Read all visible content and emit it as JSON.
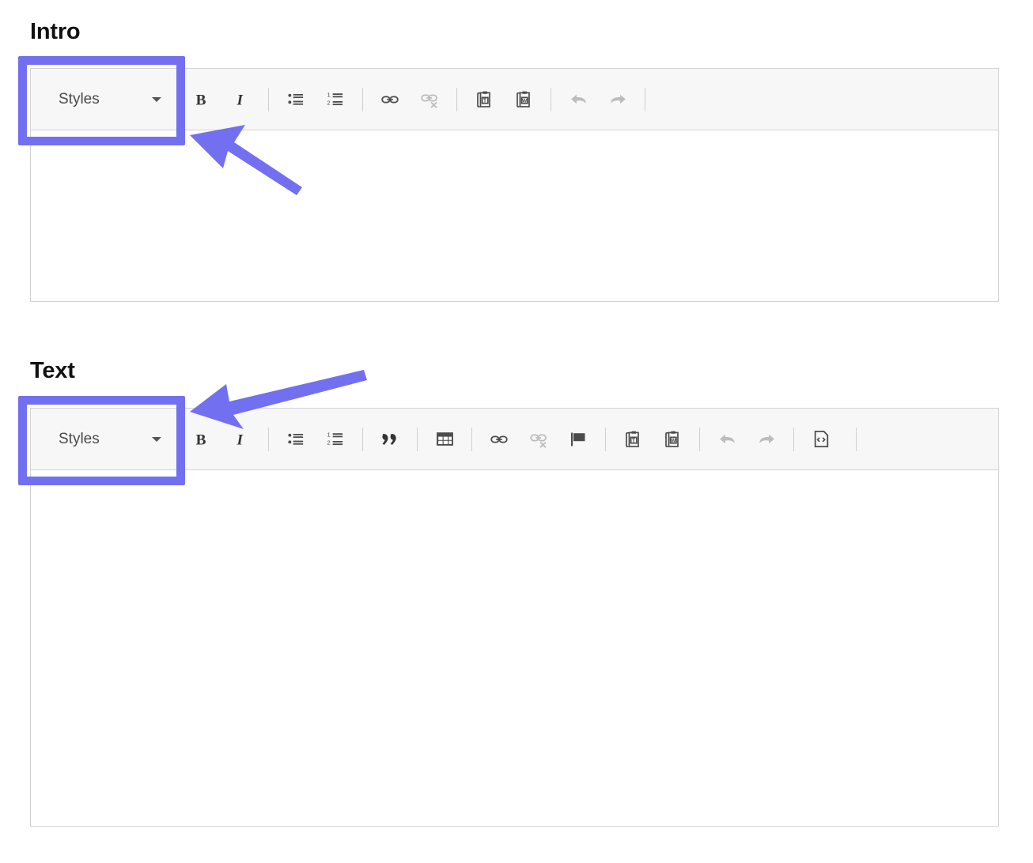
{
  "colors": {
    "highlight": "#7270f0",
    "arrow": "#7270f0",
    "toolbar_bg": "#f7f7f7",
    "border": "#d3d3d3",
    "icon": "#4c4c4c"
  },
  "sections": [
    {
      "heading": "Intro",
      "editor": {
        "styles_dropdown": {
          "label": "Styles",
          "caret_icon": "chevron-down-icon"
        },
        "toolbar_items": [
          {
            "type": "button",
            "name": "bold-button",
            "icon": "bold-icon",
            "label": "B",
            "disabled": false
          },
          {
            "type": "button",
            "name": "italic-button",
            "icon": "italic-icon",
            "label": "I",
            "disabled": false
          },
          {
            "type": "separator"
          },
          {
            "type": "button",
            "name": "bulleted-list-button",
            "icon": "bulleted-list-icon",
            "label": "",
            "disabled": false
          },
          {
            "type": "button",
            "name": "numbered-list-button",
            "icon": "numbered-list-icon",
            "label": "",
            "disabled": false
          },
          {
            "type": "separator"
          },
          {
            "type": "button",
            "name": "link-button",
            "icon": "link-icon",
            "label": "",
            "disabled": false
          },
          {
            "type": "button",
            "name": "unlink-button",
            "icon": "unlink-icon",
            "label": "",
            "disabled": true
          },
          {
            "type": "separator"
          },
          {
            "type": "button",
            "name": "paste-as-text-button",
            "icon": "paste-text-icon",
            "label": "",
            "disabled": false
          },
          {
            "type": "button",
            "name": "paste-from-word-button",
            "icon": "paste-word-icon",
            "label": "",
            "disabled": false
          },
          {
            "type": "separator"
          },
          {
            "type": "button",
            "name": "undo-button",
            "icon": "undo-icon",
            "label": "",
            "disabled": true
          },
          {
            "type": "button",
            "name": "redo-button",
            "icon": "redo-icon",
            "label": "",
            "disabled": true
          },
          {
            "type": "separator"
          }
        ],
        "content": ""
      },
      "annotation": {
        "highlight_target": "styles-dropdown",
        "arrow": "arrow-pointing-up-left"
      }
    },
    {
      "heading": "Text",
      "editor": {
        "styles_dropdown": {
          "label": "Styles",
          "caret_icon": "chevron-down-icon"
        },
        "toolbar_items": [
          {
            "type": "button",
            "name": "bold-button",
            "icon": "bold-icon",
            "label": "B",
            "disabled": false
          },
          {
            "type": "button",
            "name": "italic-button",
            "icon": "italic-icon",
            "label": "I",
            "disabled": false
          },
          {
            "type": "separator"
          },
          {
            "type": "button",
            "name": "bulleted-list-button",
            "icon": "bulleted-list-icon",
            "label": "",
            "disabled": false
          },
          {
            "type": "button",
            "name": "numbered-list-button",
            "icon": "numbered-list-icon",
            "label": "",
            "disabled": false
          },
          {
            "type": "separator"
          },
          {
            "type": "button",
            "name": "blockquote-button",
            "icon": "blockquote-icon",
            "label": "",
            "disabled": false
          },
          {
            "type": "separator"
          },
          {
            "type": "button",
            "name": "table-button",
            "icon": "table-icon",
            "label": "",
            "disabled": false
          },
          {
            "type": "separator"
          },
          {
            "type": "button",
            "name": "link-button",
            "icon": "link-icon",
            "label": "",
            "disabled": false
          },
          {
            "type": "button",
            "name": "unlink-button",
            "icon": "unlink-icon",
            "label": "",
            "disabled": true
          },
          {
            "type": "button",
            "name": "anchor-button",
            "icon": "flag-icon",
            "label": "",
            "disabled": false
          },
          {
            "type": "separator"
          },
          {
            "type": "button",
            "name": "paste-as-text-button",
            "icon": "paste-text-icon",
            "label": "",
            "disabled": false
          },
          {
            "type": "button",
            "name": "paste-from-word-button",
            "icon": "paste-word-icon",
            "label": "",
            "disabled": false
          },
          {
            "type": "separator"
          },
          {
            "type": "button",
            "name": "undo-button",
            "icon": "undo-icon",
            "label": "",
            "disabled": true
          },
          {
            "type": "button",
            "name": "redo-button",
            "icon": "redo-icon",
            "label": "",
            "disabled": true
          },
          {
            "type": "separator"
          },
          {
            "type": "button",
            "name": "source-button",
            "icon": "source-code-icon",
            "label": "Source",
            "disabled": false
          },
          {
            "type": "separator"
          }
        ],
        "content": ""
      },
      "annotation": {
        "highlight_target": "styles-dropdown",
        "arrow": "arrow-pointing-left"
      }
    }
  ]
}
